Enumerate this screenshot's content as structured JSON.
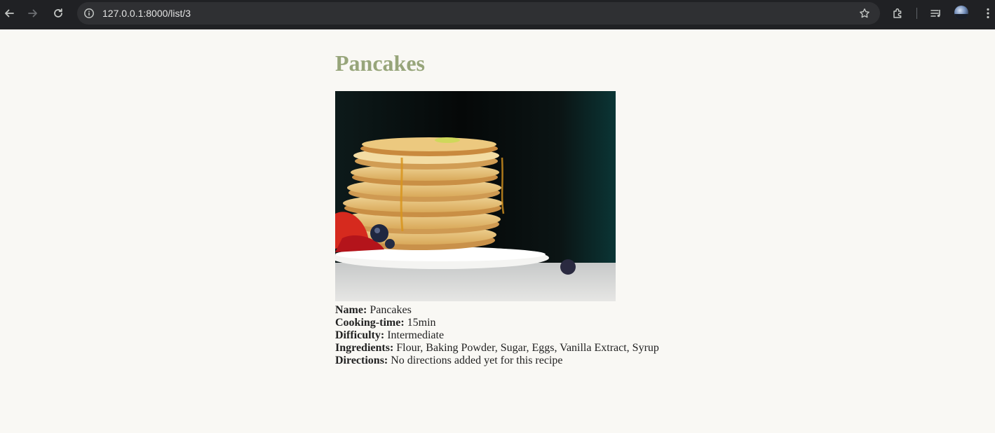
{
  "browser": {
    "url": "127.0.0.1:8000/list/3"
  },
  "page": {
    "title": "Pancakes",
    "image_subject": "stack of pancakes with syrup, strawberries and blueberries on a white plate",
    "accent_color": "#97a57a",
    "details": [
      {
        "label": "Name:",
        "value": "Pancakes"
      },
      {
        "label": "Cooking-time:",
        "value": "15min"
      },
      {
        "label": "Difficulty:",
        "value": "Intermediate"
      },
      {
        "label": "Ingredients:",
        "value": "Flour, Baking Powder, Sugar, Eggs, Vanilla Extract, Syrup"
      },
      {
        "label": "Directions:",
        "value": "No directions added yet for this recipe"
      }
    ]
  }
}
